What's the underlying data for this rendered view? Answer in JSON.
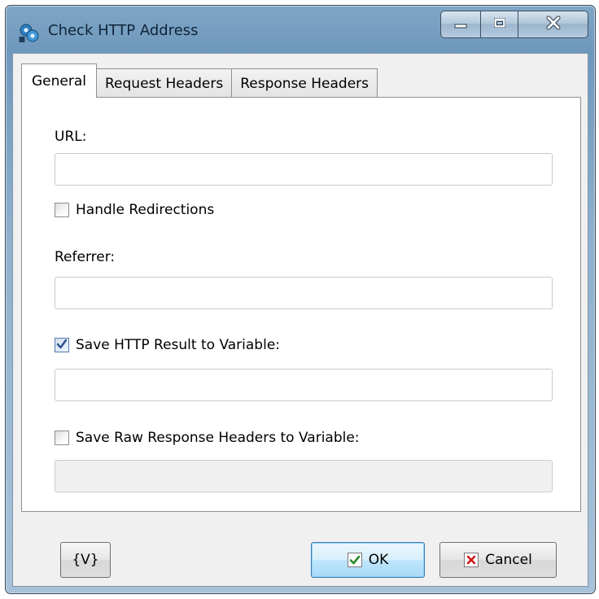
{
  "window": {
    "title": "Check HTTP Address",
    "app_icon": "gears-icon",
    "caption_buttons": [
      "minimize-icon",
      "maximize-icon",
      "close-icon"
    ]
  },
  "tabs": [
    {
      "label": "General",
      "active": true
    },
    {
      "label": "Request Headers",
      "active": false
    },
    {
      "label": "Response Headers",
      "active": false
    }
  ],
  "general": {
    "url_label": "URL:",
    "url_value": "",
    "handle_redirections_label": "Handle Redirections",
    "handle_redirections_checked": false,
    "referrer_label": "Referrer:",
    "referrer_value": "",
    "save_result_label": "Save HTTP Result to Variable:",
    "save_result_checked": true,
    "save_result_value": "",
    "save_headers_label": "Save Raw Response Headers to Variable:",
    "save_headers_checked": false,
    "save_headers_value": ""
  },
  "buttons": {
    "variables_label": "{V}",
    "ok_label": "OK",
    "ok_icon": "check-icon",
    "cancel_label": "Cancel",
    "cancel_icon": "x-icon"
  },
  "colors": {
    "ok_check": "#2a8a2a",
    "cancel_x": "#d01818",
    "checkbox_tick": "#2b4f8e"
  }
}
